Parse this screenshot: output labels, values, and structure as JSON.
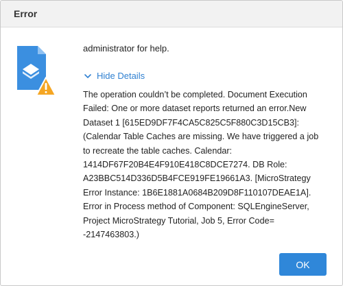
{
  "dialog": {
    "title": "Error",
    "message_tail": "administrator for help.",
    "toggle_label": "Hide Details",
    "details_text": "The operation couldn’t be completed. Document Execution Failed: One or more dataset reports returned an error.New Dataset 1 [615ED9DF7F4CA5C825C5F880C3D15CB3]: (Calendar Table Caches are missing. We have triggered a job to recreate the table caches. Calendar: 1414DF67F20B4E4F910E418C8DCE7274. DB Role: A23BBC514D336D5B4FCE919FE19661A3. [MicroStrategy Error Instance: 1B6E1881A0684B209D8F110107DEAE1A]. Error in Process method of Component: SQLEngineServer, Project MicroStrategy Tutorial, Job 5, Error Code= -2147463803.)",
    "ok_label": "OK"
  },
  "icons": {
    "document": "document-error-icon",
    "warning": "warning-icon",
    "chevron": "chevron-down-icon"
  },
  "colors": {
    "accent": "#2f87d9",
    "link": "#2f80d1",
    "warning": "#f5a623",
    "titlebar_bg": "#f2f2f2"
  }
}
